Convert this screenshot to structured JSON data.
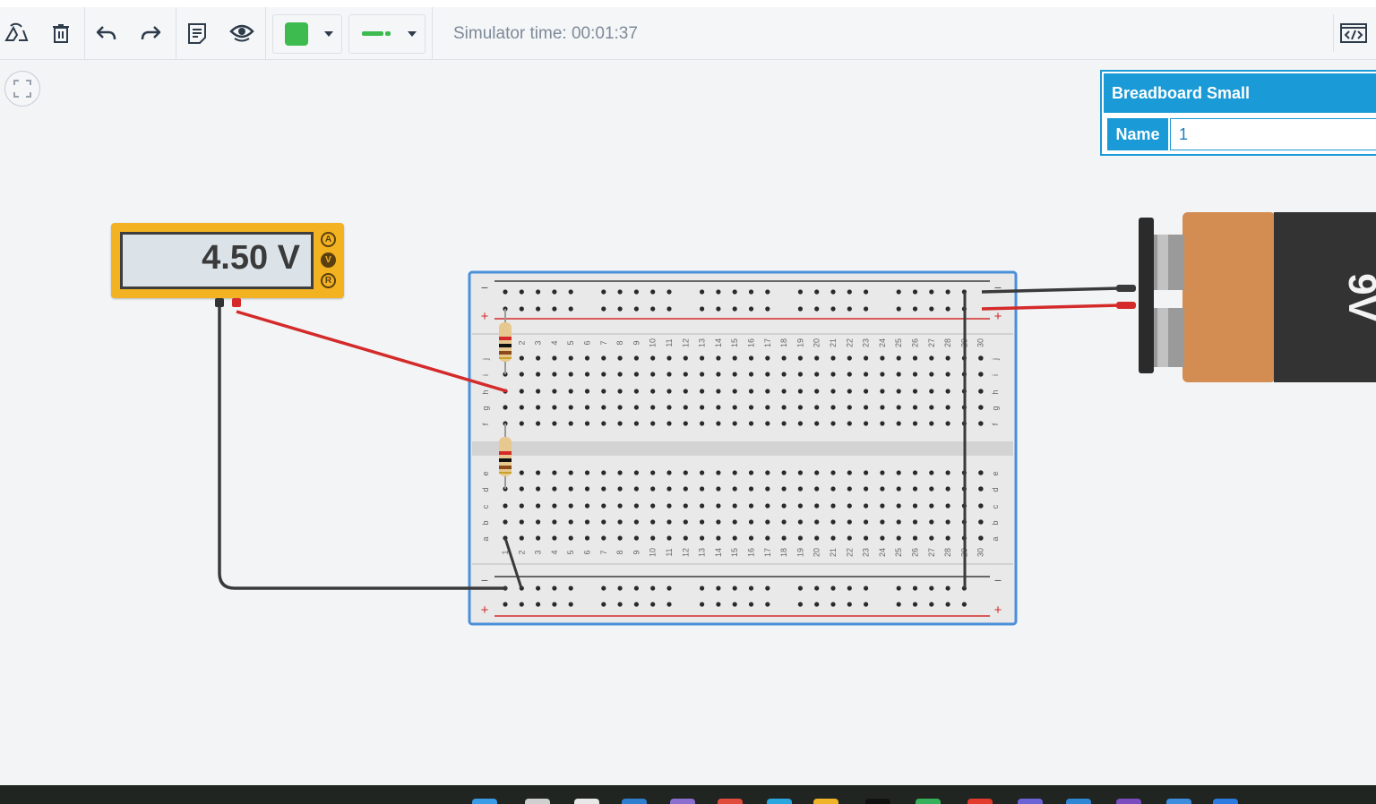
{
  "toolbar": {
    "simulator_time": "Simulator time: 00:01:37",
    "fill_color": "#3dbb4f",
    "wire_color": "#3dbb4f"
  },
  "inspector": {
    "title": "Breadboard Small",
    "name_label": "Name",
    "name_value": "1"
  },
  "multimeter": {
    "reading": "4.50 V",
    "modes": [
      "A",
      "V",
      "R"
    ],
    "active_mode": "V"
  },
  "breadboard": {
    "columns": [
      "1",
      "2",
      "3",
      "4",
      "5",
      "6",
      "7",
      "8",
      "9",
      "10",
      "11",
      "12",
      "13",
      "14",
      "15",
      "16",
      "17",
      "18",
      "19",
      "20",
      "21",
      "22",
      "23",
      "24",
      "25",
      "26",
      "27",
      "28",
      "29",
      "30"
    ],
    "rows_top": [
      "j",
      "i",
      "h",
      "g",
      "f"
    ],
    "rows_bottom": [
      "e",
      "d",
      "c",
      "b",
      "a"
    ],
    "rail_minus": "−",
    "rail_plus": "+"
  },
  "battery": {
    "label": "9V"
  },
  "colors": {
    "accent": "#1a9ad6",
    "wire_red": "#d42a2a",
    "wire_black": "#333333",
    "multimeter_body": "#f2b221"
  }
}
